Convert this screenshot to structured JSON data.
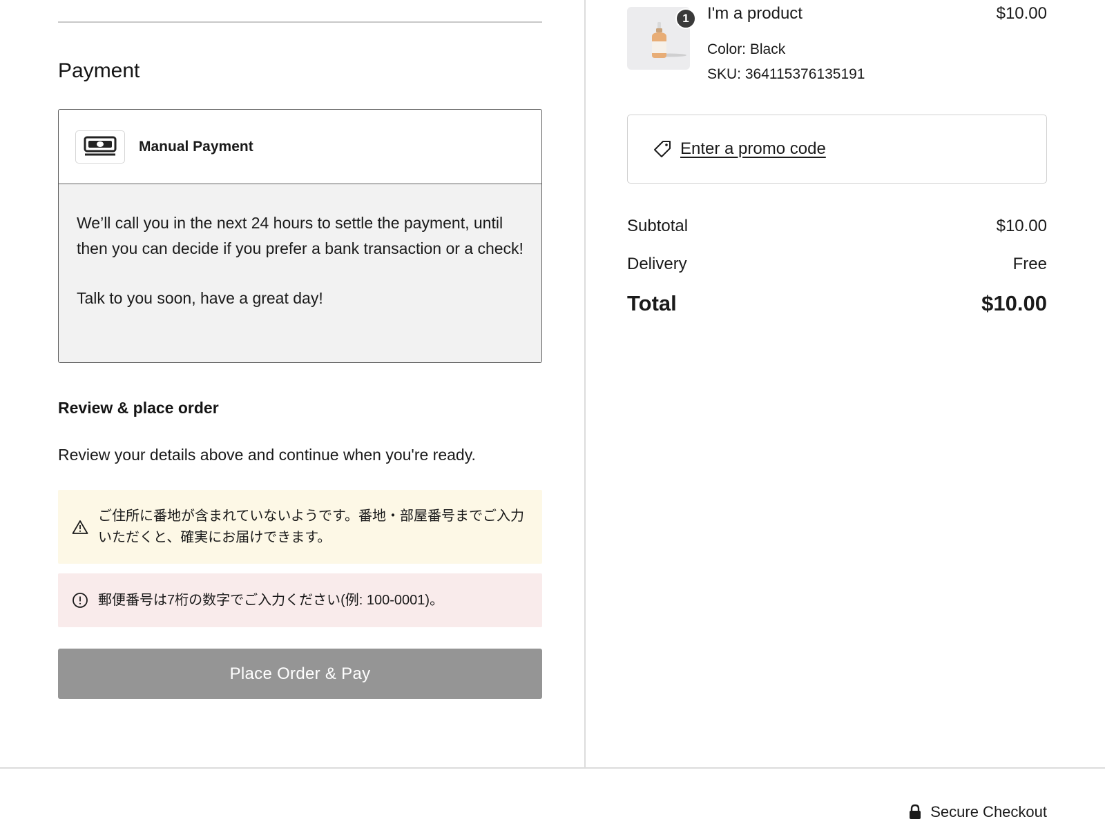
{
  "payment": {
    "section_title": "Payment",
    "method_label": "Manual Payment",
    "method_icon": "cash-icon",
    "description_line1": "We’ll call you in the next 24 hours to settle the payment, until then you can decide if you prefer a bank transaction or a check!",
    "description_line2": "Talk to you soon, have a great day!"
  },
  "review": {
    "title": "Review & place order",
    "text": "Review your details above and continue when you're ready."
  },
  "alerts": {
    "warning_text": "ご住所に番地が含まれていないようです。番地・部屋番号までご入力いただくと、確実にお届けできます。",
    "error_text": "郵便番号は7桁の数字でご入力ください(例: 100-0001)。"
  },
  "place_order_label": "Place Order & Pay",
  "product": {
    "quantity": "1",
    "name": "I'm a product",
    "price": "$10.00",
    "color": "Color: Black",
    "sku": "SKU: 364115376135191"
  },
  "promo": {
    "label": "Enter a promo code"
  },
  "summary": {
    "subtotal_label": "Subtotal",
    "subtotal_value": "$10.00",
    "delivery_label": "Delivery",
    "delivery_value": "Free",
    "total_label": "Total",
    "total_value": "$10.00"
  },
  "footer": {
    "secure_label": "Secure Checkout"
  },
  "colors": {
    "button_disabled": "#959595",
    "warning_bg": "#fdf8e6",
    "error_bg": "#f9ebeb",
    "panel_bg": "#f2f2f2"
  }
}
